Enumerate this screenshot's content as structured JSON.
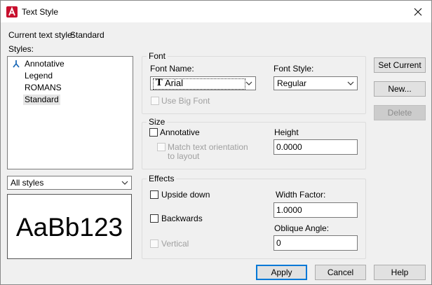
{
  "window": {
    "title": "Text Style",
    "current_style_label": "Current text style:",
    "current_style_value": "Standard"
  },
  "styles": {
    "label": "Styles:",
    "items": [
      "Annotative",
      "Legend",
      "ROMANS",
      "Standard"
    ],
    "selected": "Standard",
    "filter": "All styles",
    "preview_text": "AaBb123"
  },
  "font": {
    "group_label": "Font",
    "name_label": "Font Name:",
    "name_value": "Arial",
    "style_label": "Font Style:",
    "style_value": "Regular",
    "big_font_label": "Use Big Font"
  },
  "size": {
    "group_label": "Size",
    "annotative_label": "Annotative",
    "match_orientation_line1": "Match text orientation",
    "match_orientation_line2": "to layout",
    "height_label": "Height",
    "height_value": "0.0000"
  },
  "effects": {
    "group_label": "Effects",
    "upside_down_label": "Upside down",
    "backwards_label": "Backwards",
    "vertical_label": "Vertical",
    "width_factor_label": "Width Factor:",
    "width_factor_value": "1.0000",
    "oblique_label": "Oblique Angle:",
    "oblique_value": "0"
  },
  "buttons": {
    "set_current": "Set Current",
    "new": "New...",
    "delete": "Delete",
    "apply": "Apply",
    "cancel": "Cancel",
    "help": "Help"
  },
  "colors": {
    "accent": "#0078d7",
    "app_red": "#c8102e",
    "annotative_icon": "#1e6bb8"
  }
}
